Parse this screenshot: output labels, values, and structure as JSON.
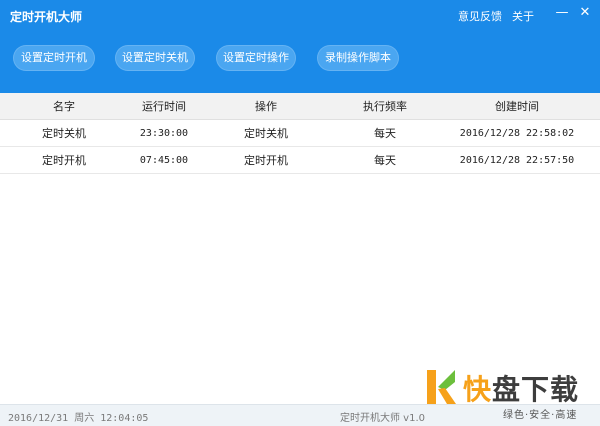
{
  "window": {
    "title": "定时开机大师",
    "links": [
      "意见反馈",
      "关于"
    ],
    "minimize_glyph": "—",
    "close_glyph": "✕"
  },
  "toolbar": {
    "buttons": [
      "设置定时开机",
      "设置定时关机",
      "设置定时操作",
      "录制操作脚本"
    ]
  },
  "table": {
    "headers": [
      "名字",
      "运行时间",
      "操作",
      "执行频率",
      "创建时间"
    ],
    "rows": [
      [
        "定时关机",
        "23:30:00",
        "定时关机",
        "每天",
        "2016/12/28 22:58:02"
      ],
      [
        "定时开机",
        "07:45:00",
        "定时开机",
        "每天",
        "2016/12/28 22:57:50"
      ]
    ]
  },
  "status": {
    "datetime": "2016/12/31 周六 12:04:05",
    "version": "定时开机大师 v1.0"
  },
  "watermark": {
    "brand_k": "快",
    "brand_rest": "盘下载",
    "slogan": "绿色·安全·高速"
  },
  "colors": {
    "header": "#1b8ae8",
    "pill": "#4aa6f1",
    "logo_orange": "#f6a11a",
    "logo_green": "#6cbf3c"
  }
}
